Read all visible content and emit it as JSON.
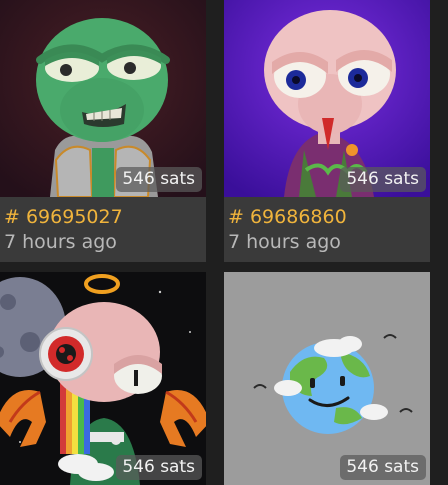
{
  "cards": [
    {
      "inscription": "# 69695027",
      "age": "7 hours ago",
      "price": "546 sats"
    },
    {
      "inscription": "# 69686860",
      "age": "7 hours ago",
      "price": "546 sats"
    },
    {
      "price": "546 sats"
    },
    {
      "price": "546 sats"
    }
  ],
  "colors": {
    "page_background": "#1f1f1f",
    "info_background": "#3a3a3a",
    "inscription_text": "#f0b43c",
    "age_text": "#b8b8b8"
  }
}
